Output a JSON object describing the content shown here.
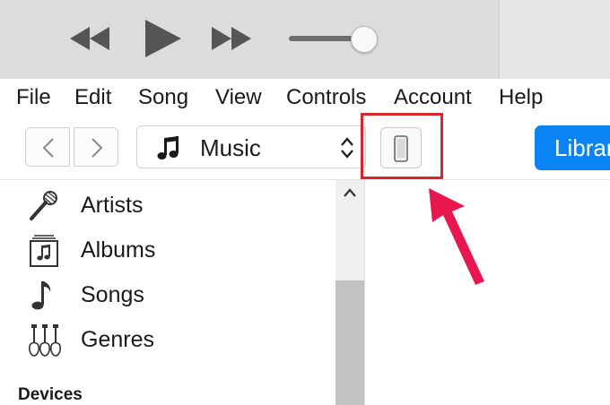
{
  "player": {
    "prev_icon": "rewind-icon",
    "play_icon": "play-icon",
    "next_icon": "fast-forward-icon",
    "volume_level": 0.88
  },
  "menu": {
    "items": [
      "File",
      "Edit",
      "Song",
      "View",
      "Controls",
      "Account",
      "Help"
    ]
  },
  "toolbar": {
    "back_icon": "chevron-left-icon",
    "forward_icon": "chevron-right-icon",
    "media_icon": "music-note-icon",
    "media_label": "Music",
    "media_selector_icon": "chevron-up-down-icon",
    "device_icon": "iphone-icon",
    "library_label": "Library"
  },
  "sidebar": {
    "items": [
      {
        "label": "Artists",
        "icon": "microphone-icon"
      },
      {
        "label": "Albums",
        "icon": "album-icon"
      },
      {
        "label": "Songs",
        "icon": "music-note-icon"
      },
      {
        "label": "Genres",
        "icon": "guitars-icon"
      }
    ],
    "section_header": "Devices"
  },
  "colors": {
    "accent": "#0a84f5",
    "highlight": "#d7262c",
    "annotation_arrow": "#e8174f"
  }
}
